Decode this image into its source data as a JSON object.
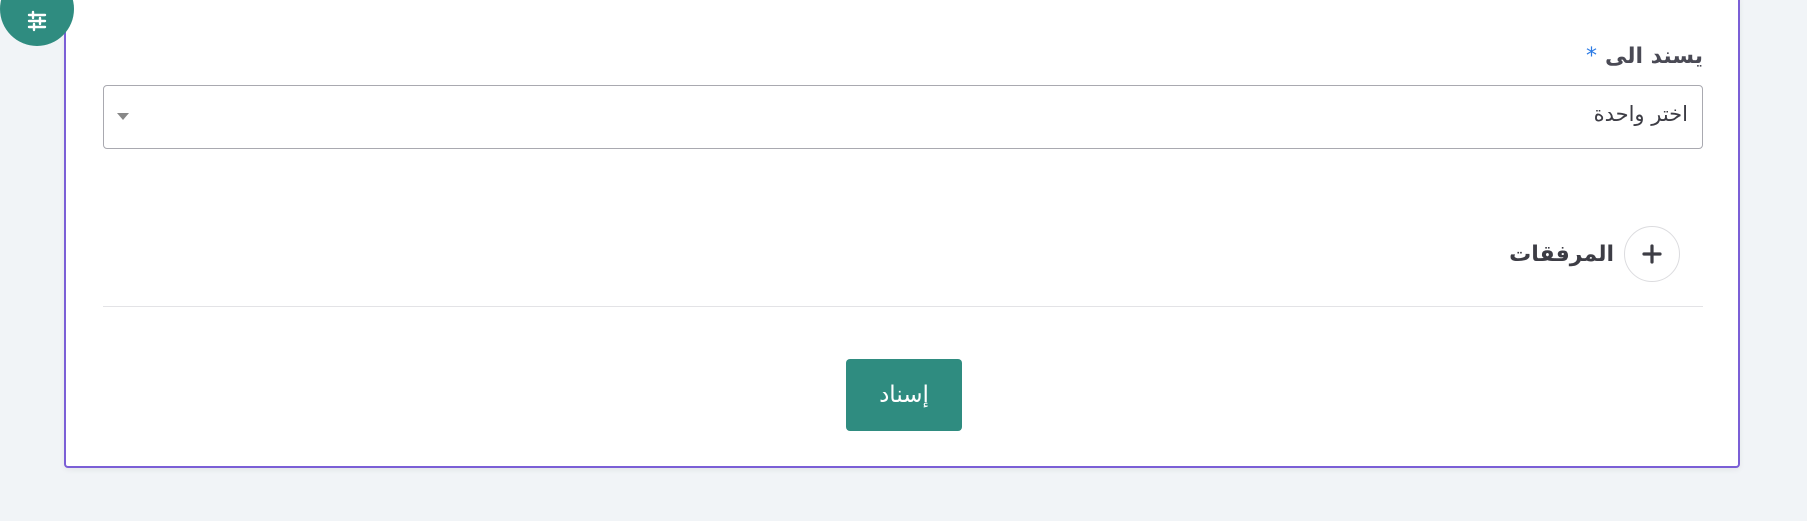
{
  "form": {
    "assign_label": "يسند الى",
    "required_marker": "*",
    "assign_select": {
      "selected_value": "اختر واحدة"
    },
    "attachments_label": "المرفقات",
    "submit_label": "إسناد"
  },
  "icons": {
    "fab": "settings-sliders-icon",
    "add": "plus-icon",
    "caret": "caret-down-icon"
  },
  "colors": {
    "primary": "#2f8c80",
    "card_border": "#7b5fd6",
    "required": "#2c7be5",
    "background": "#f1f4f7"
  }
}
